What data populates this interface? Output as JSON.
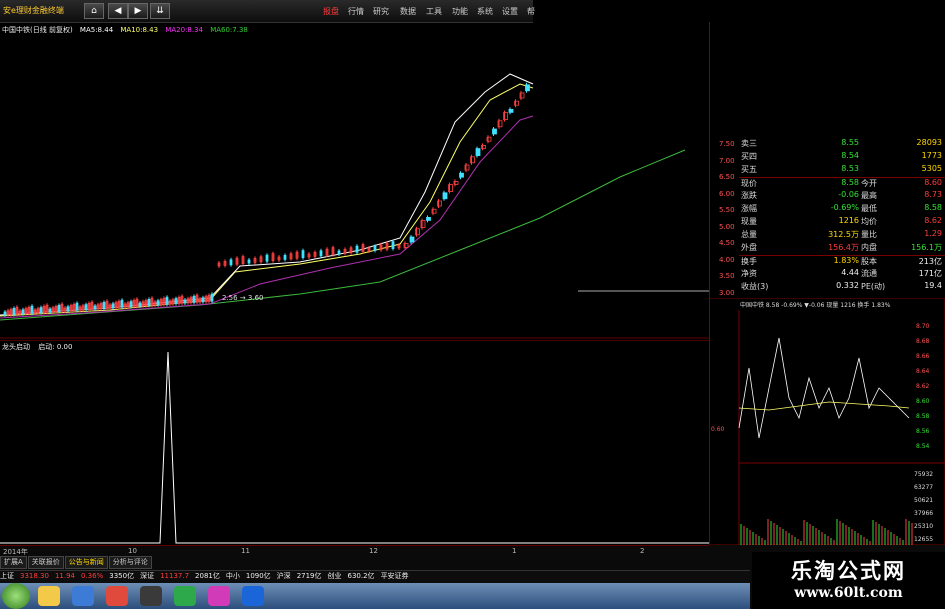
{
  "toolbar": {
    "title": "安e理财金融终端",
    "back_icon": "home-icon",
    "menu": [
      "报盘",
      "行情",
      "研究",
      "数据",
      "工具",
      "功能",
      "系统",
      "设置",
      "帮"
    ],
    "active_menu": "报盘"
  },
  "main_chart": {
    "stock_label": "中国中铁(日线 前复权)",
    "ma": [
      {
        "name": "MA5:",
        "value": "8.44",
        "color": "#ffffff"
      },
      {
        "name": "MA10:",
        "value": "8.43",
        "color": "#ffff66"
      },
      {
        "name": "MA20:",
        "value": "8.34",
        "color": "#ff33ff"
      },
      {
        "name": "MA60:",
        "value": "7.38",
        "color": "#33cc33"
      }
    ],
    "annotation": "2.56 → 3.60"
  },
  "lower_chart": {
    "label": "龙头启动",
    "sub": "启动: 0.00"
  },
  "axis": {
    "right_ticks": [
      "7.50",
      "7.00",
      "6.50",
      "6.00",
      "5.50",
      "5.00",
      "4.50",
      "4.00",
      "3.50",
      "3.00"
    ]
  },
  "dates": [
    "2014年",
    "10",
    "11",
    "12",
    "1",
    "2"
  ],
  "quote": {
    "rows": [
      {
        "l": "卖三",
        "v": "8.55",
        "vc": "green",
        "l2": "",
        "v2": "28093",
        "v2c": "yellow"
      },
      {
        "l": "买四",
        "v": "8.54",
        "vc": "green",
        "l2": "",
        "v2": "1773",
        "v2c": "yellow"
      },
      {
        "l": "买五",
        "v": "8.53",
        "vc": "green",
        "l2": "",
        "v2": "5305",
        "v2c": "yellow"
      },
      {
        "l": "现价",
        "v": "8.58",
        "vc": "green",
        "l2": "今开",
        "v2": "8.60",
        "v2c": "red"
      },
      {
        "l": "涨跌",
        "v": "-0.06",
        "vc": "green",
        "l2": "最高",
        "v2": "8.73",
        "v2c": "red"
      },
      {
        "l": "涨幅",
        "v": "-0.69%",
        "vc": "green",
        "l2": "最低",
        "v2": "8.58",
        "v2c": "green"
      },
      {
        "l": "现量",
        "v": "1216",
        "vc": "yellow",
        "l2": "均价",
        "v2": "8.62",
        "v2c": "red"
      },
      {
        "l": "总量",
        "v": "312.5万",
        "vc": "yellow",
        "l2": "量比",
        "v2": "1.29",
        "v2c": "red"
      },
      {
        "l": "外盘",
        "v": "156.4万",
        "vc": "red",
        "l2": "内盘",
        "v2": "156.1万",
        "v2c": "green"
      },
      {
        "l": "换手",
        "v": "1.83%",
        "vc": "yellow",
        "l2": "股本",
        "v2": "213亿",
        "v2c": "white"
      },
      {
        "l": "净资",
        "v": "4.44",
        "vc": "white",
        "l2": "流通",
        "v2": "171亿",
        "v2c": "white"
      },
      {
        "l": "收益(3)",
        "v": "0.332",
        "vc": "white",
        "l2": "PE(动)",
        "v2": "19.4",
        "v2c": "white"
      }
    ]
  },
  "intraday": {
    "header": "中国中铁 8.58 -0.69% ▼-0.06 现量 1216 换手 1.83%",
    "price_ticks": [
      "8.70",
      "8.68",
      "8.66",
      "8.64",
      "8.62",
      "8.60",
      "8.58",
      "8.56",
      "8.54"
    ],
    "left_ticks": [
      "0.60"
    ],
    "vol_ticks": [
      "75932",
      "63277",
      "50621",
      "37966",
      "25310",
      "12655"
    ]
  },
  "bottom": {
    "tabs": [
      "扩展A",
      "关联报价",
      "公告与新闻",
      "分析与评论"
    ],
    "active_tab": "公告与新闻",
    "ticker": [
      {
        "t": "上证",
        "c": "white"
      },
      {
        "t": "3318.30",
        "c": "red"
      },
      {
        "t": "11.94",
        "c": "red"
      },
      {
        "t": "0.36%",
        "c": "red"
      },
      {
        "t": "3350亿",
        "c": "white"
      },
      {
        "t": "深证",
        "c": "white"
      },
      {
        "t": "11137.7",
        "c": "red"
      },
      {
        "t": "2081亿",
        "c": "white"
      },
      {
        "t": "中小",
        "c": "white"
      },
      {
        "t": "1090亿",
        "c": "white"
      },
      {
        "t": "沪深",
        "c": "white"
      },
      {
        "t": "2719亿",
        "c": "white"
      },
      {
        "t": "创业",
        "c": "white"
      },
      {
        "t": "630.2亿",
        "c": "white"
      },
      {
        "t": "平安证券",
        "c": "white"
      }
    ]
  },
  "watermark": {
    "title": "乐淘公式网",
    "url": "www.60lt.com"
  }
}
